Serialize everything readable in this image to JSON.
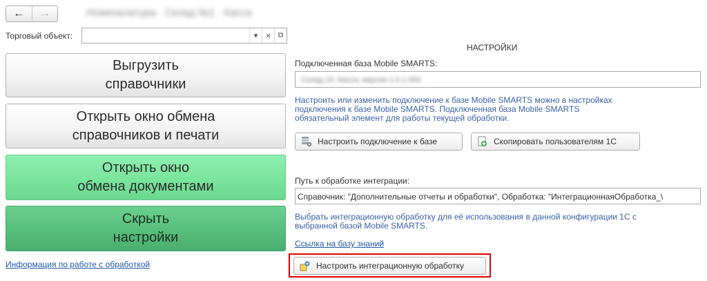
{
  "nav": {
    "back_label": "←",
    "forward_label": "→"
  },
  "window_title": "Номенклатура · Склад №1 · Касса",
  "object_field": {
    "label": "Торговый объект:",
    "value": "",
    "dropdown_glyph": "▾",
    "clear_glyph": "×",
    "open_glyph": "⧉"
  },
  "buttons": {
    "export_line1": "Выгрузить",
    "export_line2": "справочники",
    "open_exchange_line1": "Открыть окно обмена",
    "open_exchange_line2": "справочников и печати",
    "open_docs_line1": "Открыть окно",
    "open_docs_line2": "обмена документами",
    "hide_settings_line1": "Скрыть",
    "hide_settings_line2": "настройки"
  },
  "info_link": "Информация по работе с обработкой",
  "settings": {
    "heading": "НАСТРОЙКИ",
    "db_label": "Подключенная база Mobile SMARTS:",
    "db_value": "Склад 15, Касса, версия 1.0.1.000",
    "db_note_line1": "Настроить или изменить подключение к базе Mobile SMARTS можно в настройках",
    "db_note_line2": "подключения к базе Mobile SMARTS. Подключенная база Mobile SMARTS",
    "db_note_line3": "обязательный элемент для работы текущей обработки.",
    "connect_button": "Настроить подключение к базе",
    "copy_users_button": "Скопировать пользователям 1С",
    "path_label": "Путь к обработке интеграции:",
    "path_value": "Справочник: \"Дополнительные отчеты и обработки\", Обработка: \"ИнтеграционнаяОбработка_\\",
    "path_note_line1": "Выбрать интеграционную обработку для её использования в данной конфигурации 1С с",
    "path_note_line2": "выбранной базой Mobile SMARTS.",
    "kb_link": "Ссылка на базу знаний",
    "configure_button": "Настроить интеграционную обработку"
  },
  "colors": {
    "highlight": "#e00000",
    "link": "#2059a8",
    "note": "#3a62a8",
    "green_light": "#78e39b",
    "green_dark": "#55bd7b"
  },
  "icons": {
    "connect": "database-settings-icon",
    "copy": "copy-users-icon",
    "configure": "integration-settings-icon"
  }
}
